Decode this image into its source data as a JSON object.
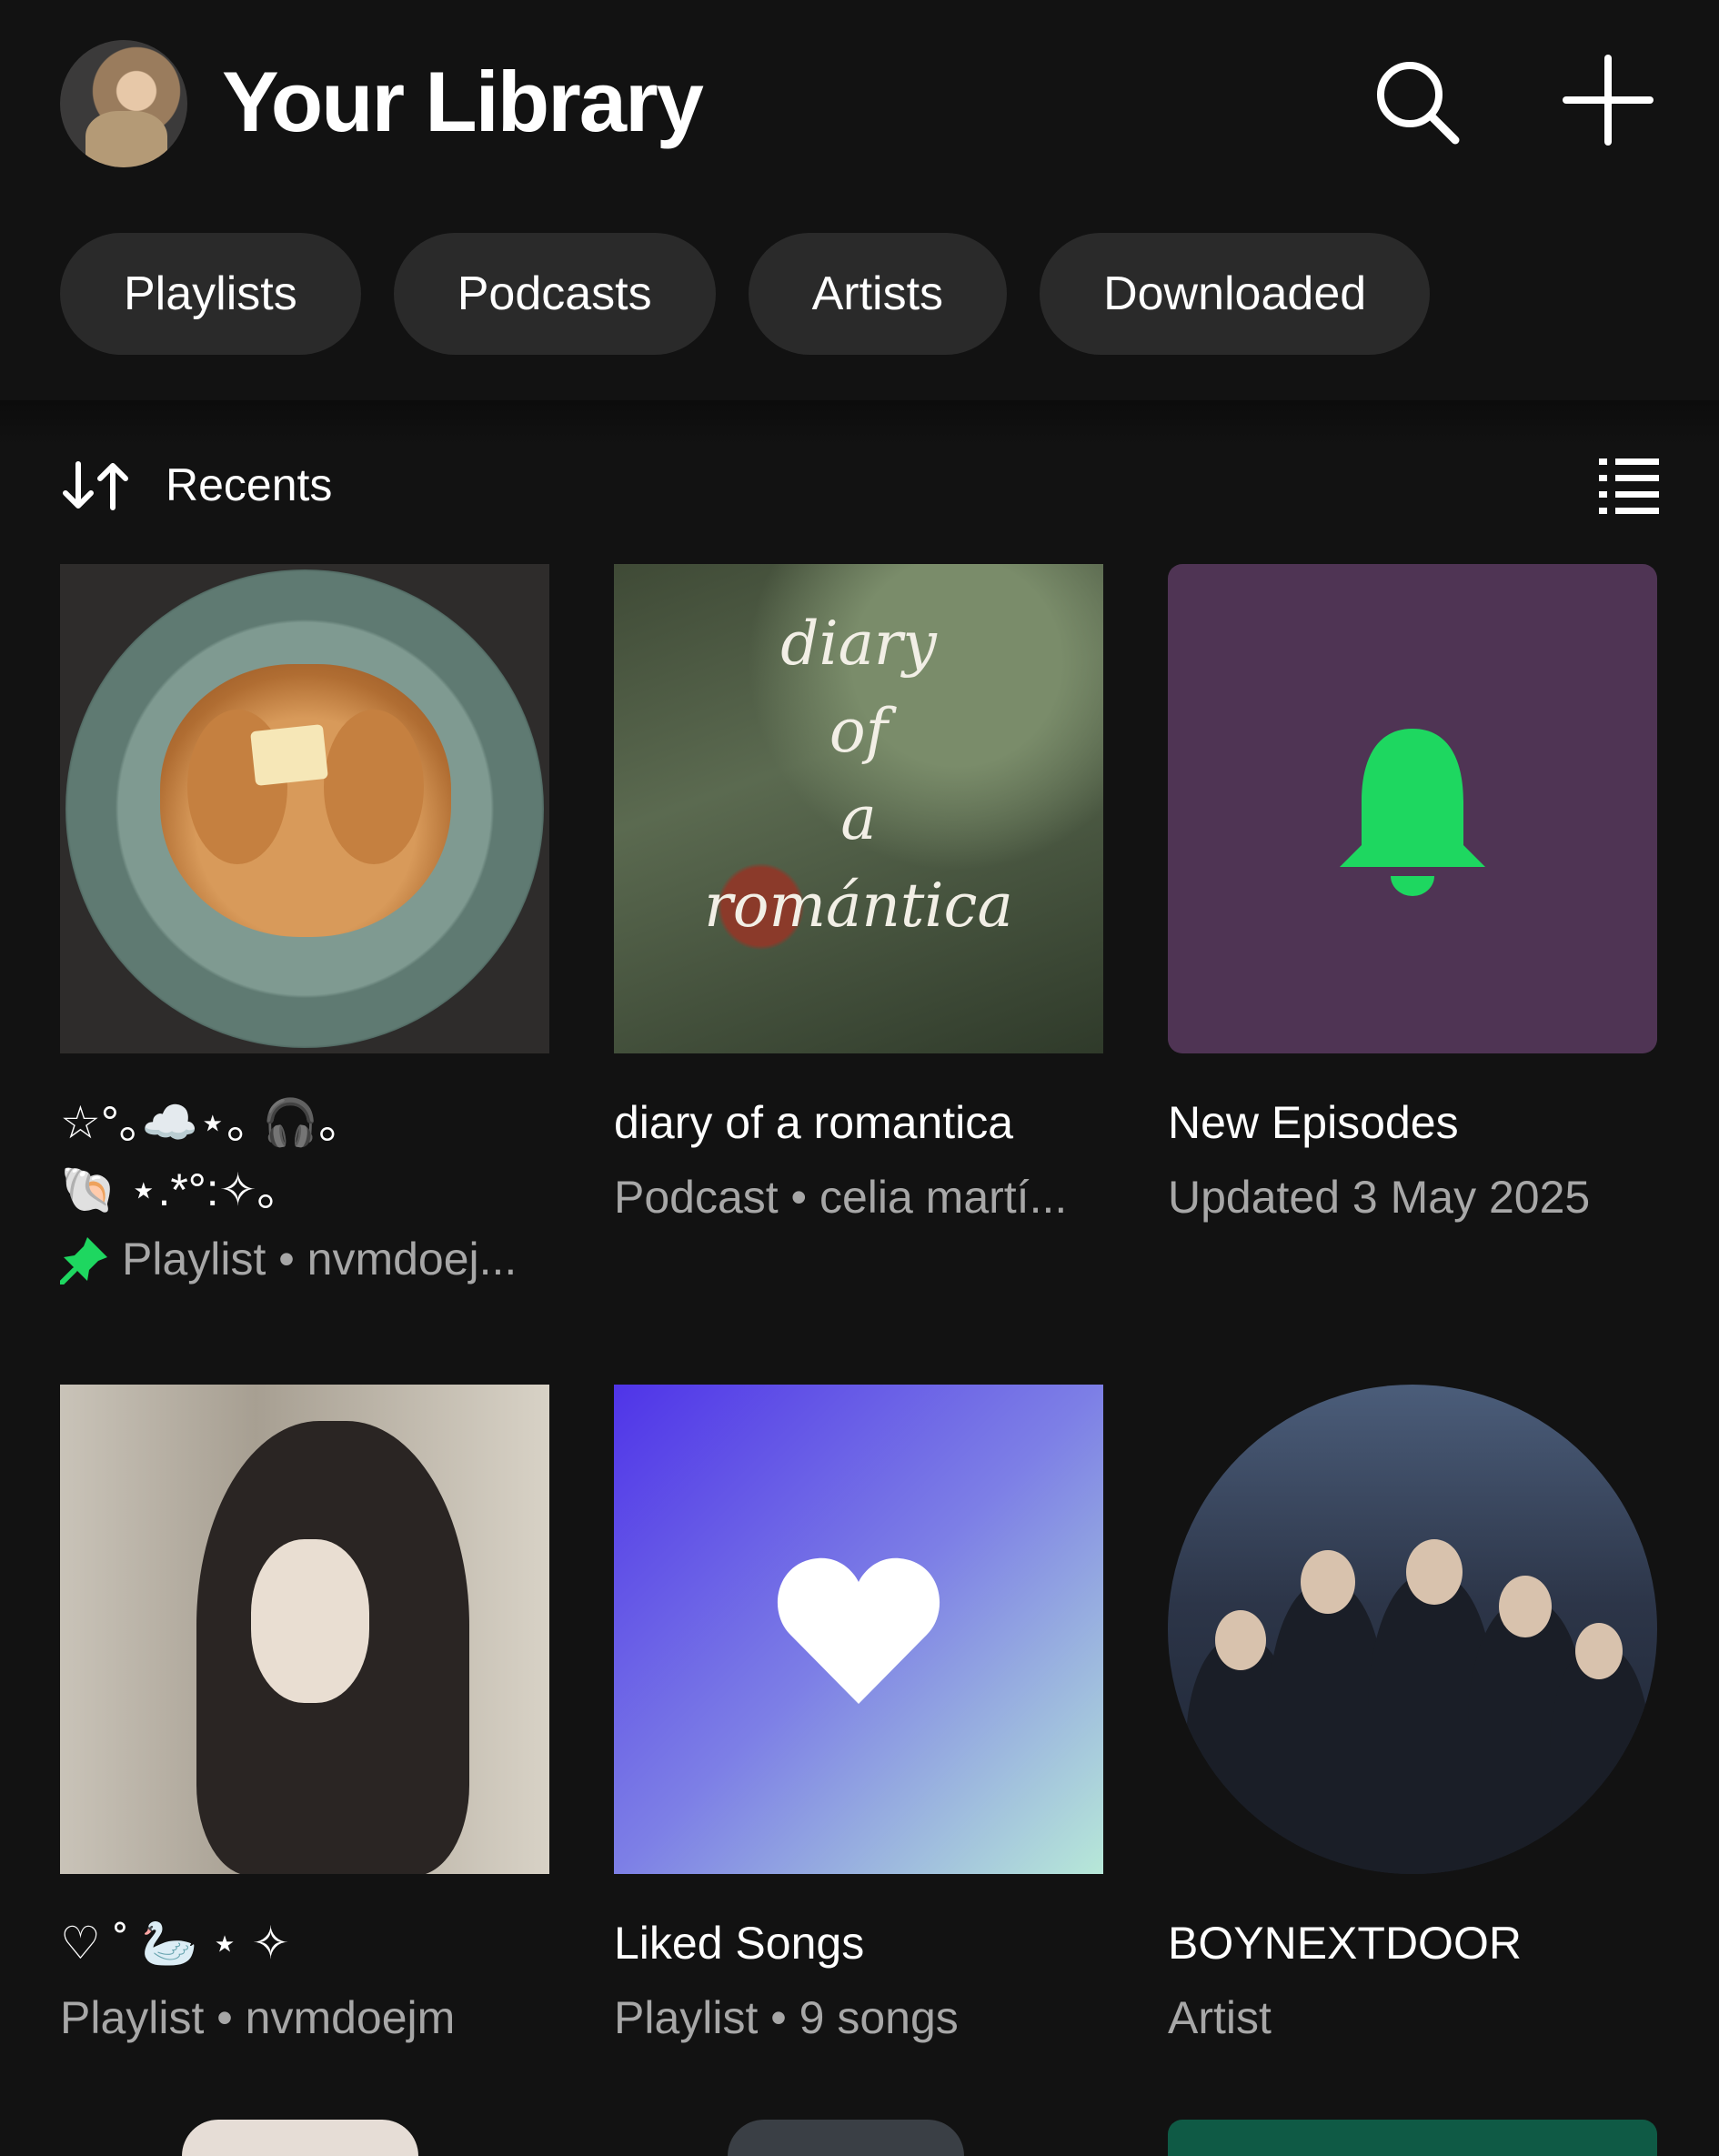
{
  "header": {
    "title": "Your Library",
    "avatar_icon": "profile-avatar",
    "search_icon": "search-icon",
    "add_icon": "plus-icon"
  },
  "filters": [
    "Playlists",
    "Podcasts",
    "Artists",
    "Downloaded"
  ],
  "sort": {
    "label": "Recents",
    "sort_icon": "sort-arrows-icon",
    "view_icon": "list-view-icon"
  },
  "colors": {
    "background": "#121212",
    "chip": "#2a2a2a",
    "accent_green": "#1ed760",
    "episodes_bg": "#4f3454",
    "secondary_text": "#a7a7a7"
  },
  "items": [
    {
      "title_line1": "☆°｡☁️⋆｡ 🎧｡",
      "title_line2": "🐚 ⋆.*°:✧｡",
      "subtitle": "Playlist • nvmdoej...",
      "pinned": true
    },
    {
      "art_text": [
        "diary",
        "of",
        "a",
        "romántica"
      ],
      "title": "diary of a romantica",
      "subtitle": "Podcast • celia martí..."
    },
    {
      "title": "New Episodes",
      "subtitle": "Updated 3 May 2025",
      "icon": "bell-icon"
    },
    {
      "title": "♡ ˚ 🦢 ⋆ ✧",
      "subtitle": "Playlist • nvmdoejm"
    },
    {
      "title": "Liked Songs",
      "subtitle": "Playlist • 9 songs",
      "icon": "heart-icon"
    },
    {
      "title": "BOYNEXTDOOR",
      "subtitle": "Artist"
    }
  ]
}
